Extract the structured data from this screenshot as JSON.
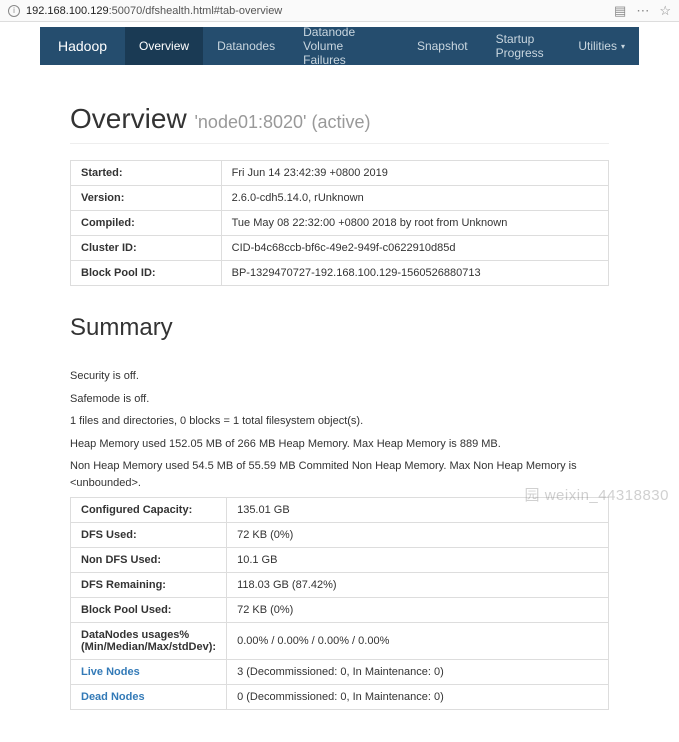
{
  "browser": {
    "url_host": "192.168.100.129",
    "url_rest": ":50070/dfshealth.html#tab-overview"
  },
  "nav": {
    "brand": "Hadoop",
    "items": [
      {
        "label": "Overview",
        "active": true
      },
      {
        "label": "Datanodes",
        "active": false
      },
      {
        "label": "Datanode Volume Failures",
        "active": false
      },
      {
        "label": "Snapshot",
        "active": false
      },
      {
        "label": "Startup Progress",
        "active": false
      },
      {
        "label": "Utilities",
        "active": false,
        "dropdown": true
      }
    ]
  },
  "overview": {
    "heading": "Overview",
    "sub": "'node01:8020' (active)",
    "rows": [
      {
        "k": "Started:",
        "v": "Fri Jun 14 23:42:39 +0800 2019"
      },
      {
        "k": "Version:",
        "v": "2.6.0-cdh5.14.0, rUnknown"
      },
      {
        "k": "Compiled:",
        "v": "Tue May 08 22:32:00 +0800 2018 by root from Unknown"
      },
      {
        "k": "Cluster ID:",
        "v": "CID-b4c68ccb-bf6c-49e2-949f-c0622910d85d"
      },
      {
        "k": "Block Pool ID:",
        "v": "BP-1329470727-192.168.100.129-1560526880713"
      }
    ]
  },
  "summary": {
    "heading": "Summary",
    "lines": [
      "Security is off.",
      "Safemode is off.",
      "1 files and directories, 0 blocks = 1 total filesystem object(s).",
      "Heap Memory used 152.05 MB of 266 MB Heap Memory. Max Heap Memory is 889 MB.",
      "Non Heap Memory used 54.5 MB of 55.59 MB Commited Non Heap Memory. Max Non Heap Memory is <unbounded>."
    ],
    "rows": [
      {
        "k": "Configured Capacity:",
        "v": "135.01 GB",
        "link": false
      },
      {
        "k": "DFS Used:",
        "v": "72 KB (0%)",
        "link": false
      },
      {
        "k": "Non DFS Used:",
        "v": "10.1 GB",
        "link": false
      },
      {
        "k": "DFS Remaining:",
        "v": "118.03 GB (87.42%)",
        "link": false
      },
      {
        "k": "Block Pool Used:",
        "v": "72 KB (0%)",
        "link": false
      },
      {
        "k": "DataNodes usages% (Min/Median/Max/stdDev):",
        "v": "0.00% / 0.00% / 0.00% / 0.00%",
        "link": false
      },
      {
        "k": "Live Nodes",
        "v": "3 (Decommissioned: 0, In Maintenance: 0)",
        "link": true
      },
      {
        "k": "Dead Nodes",
        "v": "0 (Decommissioned: 0, In Maintenance: 0)",
        "link": true
      }
    ]
  },
  "watermark": "     园 weixin_44318830"
}
